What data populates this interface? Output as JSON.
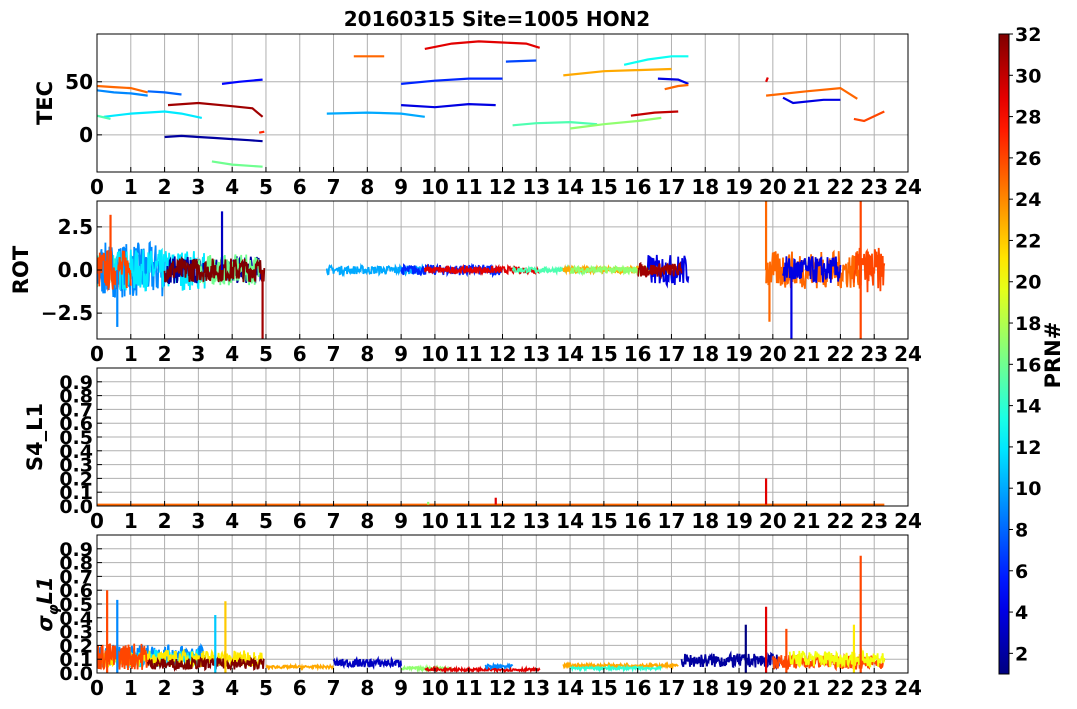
{
  "title": "20160315 Site=1005 HON2",
  "colorbar": {
    "label": "PRN#",
    "range": [
      1,
      32
    ],
    "ticks": [
      "2",
      "4",
      "6",
      "8",
      "10",
      "12",
      "14",
      "16",
      "18",
      "20",
      "22",
      "24",
      "26",
      "28",
      "30",
      "32"
    ],
    "colormap": "jet"
  },
  "x_ticks": [
    "0",
    "1",
    "2",
    "3",
    "4",
    "5",
    "6",
    "7",
    "8",
    "9",
    "10",
    "11",
    "12",
    "13",
    "14",
    "15",
    "16",
    "17",
    "18",
    "19",
    "20",
    "21",
    "22",
    "23",
    "24"
  ],
  "chart_data": [
    {
      "type": "line",
      "ylabel": "TEC",
      "xlim": [
        0,
        24
      ],
      "ylim": [
        -35,
        95
      ],
      "yticks": [
        "0",
        "50"
      ],
      "grid": true,
      "series": [
        {
          "prn": 25,
          "x": [
            0,
            0.5,
            1.0,
            1.5
          ],
          "y": [
            46,
            45,
            44,
            40
          ]
        },
        {
          "prn": 9,
          "x": [
            0,
            0.5,
            1.0,
            1.5
          ],
          "y": [
            42,
            40,
            39,
            37
          ]
        },
        {
          "prn": 8,
          "x": [
            1.5,
            2.0,
            2.5
          ],
          "y": [
            41,
            40,
            38
          ]
        },
        {
          "prn": 12,
          "x": [
            0.2,
            1.0,
            2.0,
            2.5,
            3.1
          ],
          "y": [
            17,
            20,
            22,
            20,
            16
          ]
        },
        {
          "prn": 15,
          "x": [
            0,
            0.4
          ],
          "y": [
            18,
            15
          ]
        },
        {
          "prn": 2,
          "x": [
            2.0,
            2.5,
            3.0,
            3.5,
            4.0,
            4.5,
            4.9
          ],
          "y": [
            -2,
            -1,
            -2,
            -3,
            -4,
            -5,
            -6
          ]
        },
        {
          "prn": 31,
          "x": [
            2.1,
            3.0,
            4.0,
            4.6,
            4.9
          ],
          "y": [
            28,
            30,
            27,
            25,
            17
          ]
        },
        {
          "prn": 5,
          "x": [
            3.7,
            4.2,
            4.9
          ],
          "y": [
            48,
            50,
            52
          ]
        },
        {
          "prn": 16,
          "x": [
            3.4,
            4.0,
            4.9
          ],
          "y": [
            -25,
            -28,
            -30
          ]
        },
        {
          "prn": 27,
          "x": [
            4.8,
            4.95
          ],
          "y": [
            2,
            3
          ]
        },
        {
          "prn": 10,
          "x": [
            6.8,
            8.0,
            9.0,
            9.7
          ],
          "y": [
            20,
            21,
            20,
            17
          ]
        },
        {
          "prn": 25,
          "x": [
            7.6,
            8.5
          ],
          "y": [
            74,
            74
          ]
        },
        {
          "prn": 6,
          "x": [
            9.0,
            10.0,
            11.0,
            12.0
          ],
          "y": [
            48,
            51,
            53,
            53
          ]
        },
        {
          "prn": 4,
          "x": [
            9.0,
            10.0,
            11.0,
            11.8
          ],
          "y": [
            28,
            26,
            29,
            28
          ]
        },
        {
          "prn": 29,
          "x": [
            9.7,
            10.5,
            11.3,
            12.0,
            12.7,
            13.1
          ],
          "y": [
            81,
            86,
            88,
            87,
            86,
            82
          ]
        },
        {
          "prn": 7,
          "x": [
            12.1,
            13.0
          ],
          "y": [
            69,
            70
          ]
        },
        {
          "prn": 15,
          "x": [
            12.3,
            13.0,
            14.0,
            14.8
          ],
          "y": [
            9,
            11,
            12,
            10
          ]
        },
        {
          "prn": 23,
          "x": [
            13.8,
            15.0,
            16.0,
            17.0
          ],
          "y": [
            56,
            60,
            61,
            62
          ]
        },
        {
          "prn": 17,
          "x": [
            14.0,
            15.0,
            16.0,
            16.7
          ],
          "y": [
            6,
            10,
            13,
            16
          ]
        },
        {
          "prn": 13,
          "x": [
            15.6,
            16.3,
            17.0,
            17.5
          ],
          "y": [
            66,
            71,
            74,
            74
          ]
        },
        {
          "prn": 30,
          "x": [
            15.8,
            16.5,
            17.2
          ],
          "y": [
            18,
            21,
            22
          ]
        },
        {
          "prn": 4,
          "x": [
            16.6,
            17.2,
            17.5
          ],
          "y": [
            53,
            52,
            48
          ]
        },
        {
          "prn": 25,
          "x": [
            16.8,
            17.2,
            17.5
          ],
          "y": [
            43,
            46,
            47
          ]
        },
        {
          "prn": 29,
          "x": [
            19.8,
            19.85
          ],
          "y": [
            50,
            54
          ]
        },
        {
          "prn": 25,
          "x": [
            19.8,
            21.0,
            22.0,
            22.5
          ],
          "y": [
            37,
            41,
            44,
            34
          ]
        },
        {
          "prn": 4,
          "x": [
            20.3,
            20.6,
            21.5,
            22.0
          ],
          "y": [
            35,
            30,
            33,
            33
          ]
        },
        {
          "prn": 26,
          "x": [
            22.4,
            22.7,
            23.3
          ],
          "y": [
            15,
            13,
            22
          ]
        }
      ]
    },
    {
      "type": "line",
      "ylabel": "ROT",
      "xlim": [
        0,
        24
      ],
      "ylim": [
        -4,
        4
      ],
      "yticks": [
        "2.5",
        "0.0",
        "−2.5"
      ],
      "grid": true,
      "segments": [
        {
          "prn": 14,
          "x": [
            0,
            1.2
          ],
          "amp": 1.0
        },
        {
          "prn": 9,
          "x": [
            0,
            2.0
          ],
          "amp": 1.6
        },
        {
          "prn": 12,
          "x": [
            0.5,
            3.2
          ],
          "amp": 1.2
        },
        {
          "prn": 26,
          "x": [
            0,
            1.0
          ],
          "amp": 1.2
        },
        {
          "prn": 2,
          "x": [
            2.0,
            4.9
          ],
          "amp": 0.8
        },
        {
          "prn": 16,
          "x": [
            3.0,
            4.8
          ],
          "amp": 0.9
        },
        {
          "prn": 32,
          "x": [
            2.0,
            4.95
          ],
          "amp": 0.7
        },
        {
          "prn": 10,
          "x": [
            6.8,
            9.7
          ],
          "amp": 0.25
        },
        {
          "prn": 6,
          "x": [
            9.0,
            12.0
          ],
          "amp": 0.3
        },
        {
          "prn": 29,
          "x": [
            9.7,
            13.1
          ],
          "amp": 0.2
        },
        {
          "prn": 15,
          "x": [
            12.3,
            14.8
          ],
          "amp": 0.15
        },
        {
          "prn": 23,
          "x": [
            13.8,
            17.0
          ],
          "amp": 0.2
        },
        {
          "prn": 17,
          "x": [
            14.0,
            16.7
          ],
          "amp": 0.2
        },
        {
          "prn": 4,
          "x": [
            16.3,
            17.5
          ],
          "amp": 0.9
        },
        {
          "prn": 31,
          "x": [
            16.0,
            17.3
          ],
          "amp": 0.4
        },
        {
          "prn": 25,
          "x": [
            19.8,
            22.6
          ],
          "amp": 1.1
        },
        {
          "prn": 4,
          "x": [
            20.3,
            22.0
          ],
          "amp": 0.8
        },
        {
          "prn": 26,
          "x": [
            22.4,
            23.3
          ],
          "amp": 1.3
        }
      ],
      "spikes": [
        {
          "prn": 26,
          "x": 0.4,
          "y": 3.2
        },
        {
          "prn": 9,
          "x": 0.6,
          "y": -3.3
        },
        {
          "prn": 3,
          "x": 3.7,
          "y": 3.4
        },
        {
          "prn": 31,
          "x": 4.9,
          "y": -4.0
        },
        {
          "prn": 25,
          "x": 19.8,
          "y": 4.0
        },
        {
          "prn": 25,
          "x": 19.9,
          "y": -3.0
        },
        {
          "prn": 4,
          "x": 20.55,
          "y": -4.0
        },
        {
          "prn": 26,
          "x": 22.6,
          "y": 4.0
        },
        {
          "prn": 26,
          "x": 22.6,
          "y": -4.0
        }
      ]
    },
    {
      "type": "line",
      "ylabel": "S4_L1",
      "xlim": [
        0,
        24
      ],
      "ylim": [
        0,
        1.0
      ],
      "yticks": [
        "0.0",
        "0.1",
        "0.2",
        "0.3",
        "0.4",
        "0.5",
        "0.6",
        "0.7",
        "0.8",
        "0.9"
      ],
      "grid": true,
      "baseline": 0.01,
      "spikes": [
        {
          "prn": 17,
          "x": 9.8,
          "y": 0.03
        },
        {
          "prn": 29,
          "x": 11.8,
          "y": 0.06
        },
        {
          "prn": 29,
          "x": 19.8,
          "y": 0.2
        }
      ]
    },
    {
      "type": "line",
      "ylabel": "σ_φL1",
      "xlim": [
        0,
        24
      ],
      "ylim": [
        0,
        1.0
      ],
      "yticks": [
        "0.0",
        "0.1",
        "0.2",
        "0.3",
        "0.4",
        "0.5",
        "0.6",
        "0.7",
        "0.8",
        "0.9"
      ],
      "grid": true,
      "segments": [
        {
          "prn": 9,
          "x": [
            0,
            3.2
          ],
          "base": 0.1,
          "amp": 0.15
        },
        {
          "prn": 12,
          "x": [
            0.3,
            3.0
          ],
          "base": 0.08,
          "amp": 0.12
        },
        {
          "prn": 21,
          "x": [
            0,
            4.9
          ],
          "base": 0.08,
          "amp": 0.12
        },
        {
          "prn": 26,
          "x": [
            0,
            1.5
          ],
          "base": 0.08,
          "amp": 0.2
        },
        {
          "prn": 32,
          "x": [
            1.5,
            4.95
          ],
          "base": 0.05,
          "amp": 0.08
        },
        {
          "prn": 23,
          "x": [
            5.0,
            7.0
          ],
          "base": 0.04,
          "amp": 0.02
        },
        {
          "prn": 3,
          "x": [
            7.0,
            9.0
          ],
          "base": 0.06,
          "amp": 0.06
        },
        {
          "prn": 17,
          "x": [
            9.0,
            10.5
          ],
          "base": 0.03,
          "amp": 0.02
        },
        {
          "prn": 29,
          "x": [
            9.7,
            13.1
          ],
          "base": 0.02,
          "amp": 0.02
        },
        {
          "prn": 9,
          "x": [
            11.5,
            12.3
          ],
          "base": 0.04,
          "amp": 0.03
        },
        {
          "prn": 23,
          "x": [
            13.8,
            17.2
          ],
          "base": 0.05,
          "amp": 0.02
        },
        {
          "prn": 14,
          "x": [
            14.0,
            16.7
          ],
          "base": 0.03,
          "amp": 0.02
        },
        {
          "prn": 2,
          "x": [
            17.3,
            20.2
          ],
          "base": 0.07,
          "amp": 0.1
        },
        {
          "prn": 26,
          "x": [
            20.0,
            23.3
          ],
          "base": 0.06,
          "amp": 0.1
        },
        {
          "prn": 20,
          "x": [
            20.5,
            23.3
          ],
          "base": 0.08,
          "amp": 0.12
        }
      ],
      "spikes": [
        {
          "prn": 26,
          "x": 0.3,
          "y": 0.6
        },
        {
          "prn": 9,
          "x": 0.6,
          "y": 0.53
        },
        {
          "prn": 22,
          "x": 3.8,
          "y": 0.52
        },
        {
          "prn": 11,
          "x": 3.5,
          "y": 0.42
        },
        {
          "prn": 1,
          "x": 19.2,
          "y": 0.35
        },
        {
          "prn": 29,
          "x": 19.8,
          "y": 0.48
        },
        {
          "prn": 26,
          "x": 20.4,
          "y": 0.32
        },
        {
          "prn": 26,
          "x": 22.6,
          "y": 0.85
        },
        {
          "prn": 21,
          "x": 22.4,
          "y": 0.35
        }
      ]
    }
  ]
}
